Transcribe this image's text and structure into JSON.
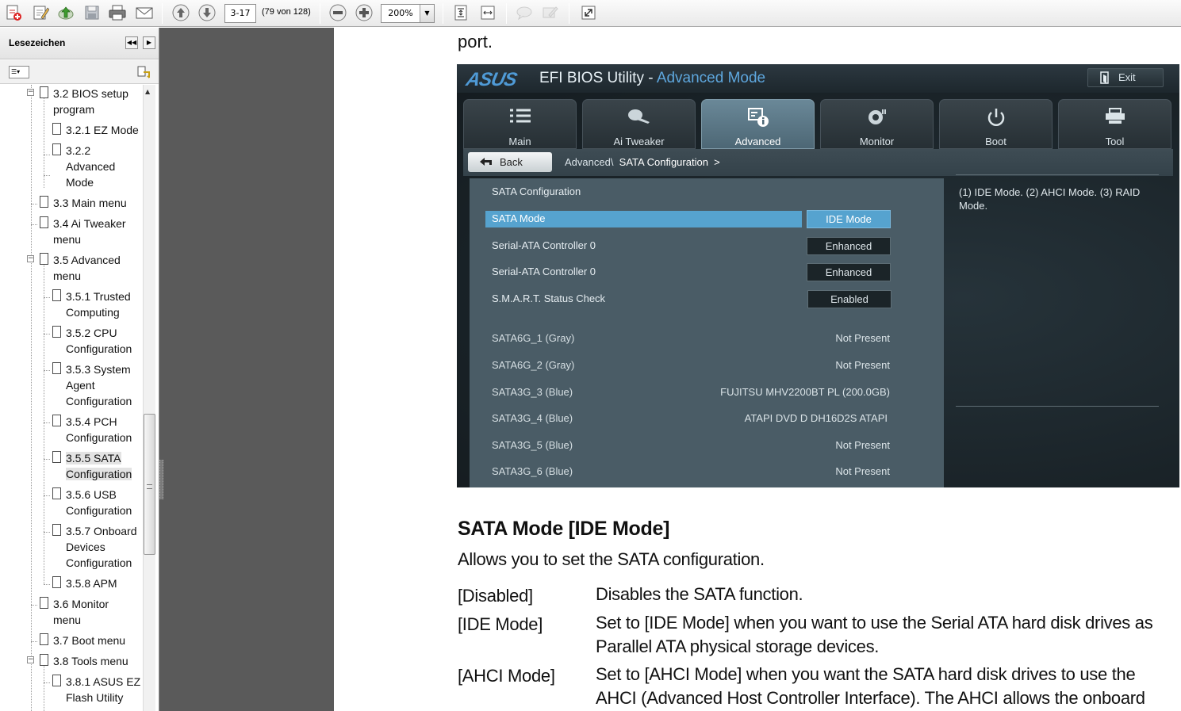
{
  "toolbar": {
    "page_input": "3-17",
    "page_count": "(79 von 128)",
    "zoom_value": "200%"
  },
  "bookmarks": {
    "title": "Lesezeichen",
    "items": [
      "3.2 BIOS setup",
      "program",
      "3.2.1 EZ Mode",
      "3.2.2",
      "Advanced",
      "Mode",
      "3.3 Main menu",
      "3.4 Ai Tweaker",
      "menu",
      "3.5 Advanced",
      "menu",
      "3.5.1 Trusted",
      "Computing",
      "3.5.2 CPU",
      "Configuration",
      "3.5.3 System",
      "Agent",
      "Configuration",
      "3.5.4 PCH",
      "Configuration",
      "3.5.5 SATA",
      "Configuration",
      "3.5.6 USB",
      "Configuration",
      "3.5.7 Onboard",
      "Devices",
      "Configuration",
      "3.5.8 APM",
      "3.6 Monitor",
      "menu",
      "3.7 Boot menu",
      "3.8 Tools menu",
      "3.8.1 ASUS EZ",
      "Flash Utility"
    ]
  },
  "doc": {
    "port": "port.",
    "heading": "SATA Mode [IDE Mode]",
    "intro": "Allows you to set the SATA configuration.",
    "options": [
      {
        "key": "[Disabled]",
        "desc": "Disables the SATA function."
      },
      {
        "key": "[IDE Mode]",
        "desc": "Set to [IDE Mode] when you want to use the Serial ATA hard disk drives as Parallel ATA physical storage devices."
      },
      {
        "key": "[AHCI Mode]",
        "desc": "Set to [AHCI Mode] when you want the SATA hard disk drives to use the AHCI (Advanced Host Controller Interface). The AHCI allows the onboard"
      }
    ]
  },
  "bios": {
    "logo": "ASUS",
    "title_main": "EFI BIOS Utility - ",
    "title_sub": "Advanced Mode",
    "exit": "Exit",
    "tabs": [
      "Main",
      "Ai  Tweaker",
      "Advanced",
      "Monitor",
      "Boot",
      "Tool"
    ],
    "back": "Back",
    "crumb_parent": "Advanced\\",
    "crumb_current": "SATA Configuration",
    "crumb_arrow": ">",
    "section": "SATA Configuration",
    "settings": [
      {
        "label": "SATA Mode",
        "value": "IDE Mode"
      },
      {
        "label": "Serial-ATA Controller 0",
        "value": "Enhanced"
      },
      {
        "label": "Serial-ATA Controller 0",
        "value": "Enhanced"
      },
      {
        "label": "S.M.A.R.T. Status Check",
        "value": "Enabled"
      }
    ],
    "ports": [
      {
        "label": "SATA6G_1 (Gray)",
        "value": "Not Present"
      },
      {
        "label": "SATA6G_2 (Gray)",
        "value": "Not Present"
      },
      {
        "label": "SATA3G_3 (Blue)",
        "value": "FUJITSU MHV2200BT PL (200.0GB)"
      },
      {
        "label": "SATA3G_4 (Blue)",
        "value": "ATAPI DVD D DH16D2S ATAPI"
      },
      {
        "label": "SATA3G_5 (Blue)",
        "value": "Not Present"
      },
      {
        "label": "SATA3G_6 (Blue)",
        "value": "Not Present"
      }
    ],
    "help": "(1) IDE Mode. (2) AHCI Mode. (3) RAID Mode."
  },
  "colors": {
    "bios_accent": "#56a3cf",
    "toolbar_bg": "#efefef",
    "splitter": "#5a5a5a"
  }
}
